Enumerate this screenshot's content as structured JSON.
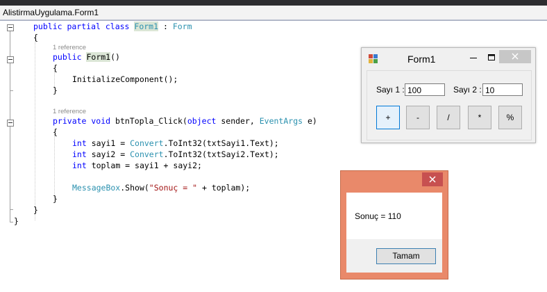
{
  "tab": {
    "title": "AlistirmaUygulama.Form1"
  },
  "code": {
    "class_decl": {
      "kw": "public partial class ",
      "name": "Form1",
      "sep": " : ",
      "base": "Form"
    },
    "open_brace": "{",
    "ref1": "1 reference",
    "ctor": {
      "kw": "public ",
      "name": "Form1",
      "rest": "()"
    },
    "ctor_open": "{",
    "init_call": "InitializeComponent();",
    "ctor_close": "}",
    "ref2": "1 reference",
    "method": {
      "kw": "private void ",
      "name": "btnTopla_Click(",
      "kw2": "object",
      "p1": " sender, ",
      "type": "EventArgs",
      "p2": " e)"
    },
    "method_open": "{",
    "line_sayi1": {
      "kw": "int",
      "a": " sayi1 = ",
      "type": "Convert",
      "b": ".ToInt32(txtSayi1.Text);"
    },
    "line_sayi2": {
      "kw": "int",
      "a": " sayi2 = ",
      "type": "Convert",
      "b": ".ToInt32(txtSayi2.Text);"
    },
    "line_toplam": {
      "kw": "int",
      "a": " toplam = sayi1 + sayi2;"
    },
    "line_msg": {
      "type": "MessageBox",
      "a": ".Show(",
      "str": "\"Sonuç = \"",
      "b": " + toplam);"
    },
    "method_close": "}",
    "class_close": "}",
    "ns_close": "}"
  },
  "form1": {
    "title": "Form1",
    "min_glyph": "–",
    "max_glyph": "☐",
    "close_glyph": "✕",
    "label1": "Sayı 1 :",
    "value1": "100",
    "label2": "Sayı 2 :",
    "value2": "10",
    "buttons": [
      "+",
      "-",
      "/",
      "*",
      "%"
    ]
  },
  "messagebox": {
    "close_glyph": "✕",
    "text": "Sonuç = 110",
    "ok_label": "Tamam"
  },
  "colors": {
    "keyword": "#0000ff",
    "type": "#2b91af",
    "string": "#a31515",
    "msgbox_frame": "#e9896a"
  }
}
